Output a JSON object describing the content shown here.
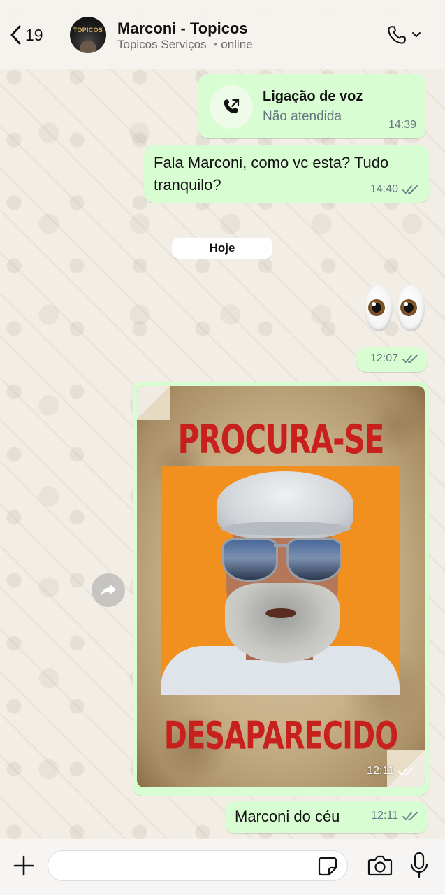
{
  "header": {
    "back_count": "19",
    "contact_name": "Marconi - Topicos",
    "contact_subtitle": "Topicos Serviços",
    "status": "online",
    "avatar_logo_text": "TOPICOS"
  },
  "messages": {
    "call": {
      "title": "Ligação de voz",
      "subtitle": "Não atendida",
      "time": "14:39"
    },
    "text1": {
      "line1": "Fala Marconi, como vc esta? Tudo",
      "line2": "tranquilo?",
      "time": "14:40"
    },
    "date_chip": "Hoje",
    "emoji_time": "12:07",
    "image": {
      "heading_top": "PROCURA-SE",
      "heading_bottom": "DESAPARECIDO",
      "time": "12:11"
    },
    "text2": {
      "text": "Marconi do céu",
      "time": "12:11"
    }
  },
  "composer": {
    "input_value": "",
    "input_placeholder": ""
  },
  "colors": {
    "outgoing_bubble": "#d9fdd3",
    "wallpaper": "#efeae2",
    "poster_red": "#c8211d",
    "poster_orange": "#f2901f"
  }
}
